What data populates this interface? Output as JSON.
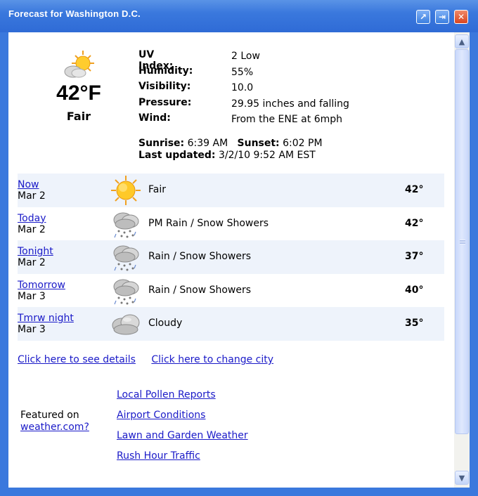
{
  "window": {
    "title": "Forecast for Washington D.C.",
    "buttons": {
      "restore": "↗",
      "pin": "⇥",
      "close": "✕"
    }
  },
  "current": {
    "icon": "sun-cloud-icon",
    "temperature": "42°F",
    "condition": "Fair",
    "details": [
      {
        "label": "UV Index:",
        "value": "2 Low"
      },
      {
        "label": "Humidity:",
        "value": "55%"
      },
      {
        "label": "Visibility:",
        "value": "10.0"
      },
      {
        "label": "Pressure:",
        "value": "29.95 inches and falling"
      },
      {
        "label": "Wind:",
        "value": "From the ENE at 6mph"
      }
    ],
    "sunrise_label": "Sunrise:",
    "sunrise": "6:39 AM",
    "sunset_label": "Sunset:",
    "sunset": "6:02 PM",
    "updated_label": "Last updated:",
    "updated": "3/2/10 9:52 AM EST"
  },
  "forecast": [
    {
      "period": "Now",
      "date": "Mar 2",
      "icon": "sun-icon",
      "condition": "Fair",
      "temp": "42°"
    },
    {
      "period": "Today",
      "date": "Mar 2",
      "icon": "rain-snow-icon",
      "condition": "PM Rain / Snow Showers",
      "temp": "42°"
    },
    {
      "period": "Tonight",
      "date": "Mar 2",
      "icon": "rain-snow-icon",
      "condition": "Rain / Snow Showers",
      "temp": "37°"
    },
    {
      "period": "Tomorrow",
      "date": "Mar 3",
      "icon": "rain-snow-icon",
      "condition": "Rain / Snow Showers",
      "temp": "40°"
    },
    {
      "period": "Tmrw night",
      "date": "Mar 3",
      "icon": "cloud-icon",
      "condition": "Cloudy",
      "temp": "35°"
    }
  ],
  "links": {
    "details": "Click here to see details",
    "change_city": "Click here to change city"
  },
  "featured": {
    "label": "Featured on",
    "site": "weather.com?"
  },
  "external_links": [
    "Local Pollen Reports",
    "Airport Conditions",
    "Lawn and Garden Weather",
    "Rush Hour Traffic"
  ],
  "colors": {
    "titlebar": "#3a78dd",
    "link": "#1a1ac8",
    "row_shade": "#eef3fb"
  }
}
